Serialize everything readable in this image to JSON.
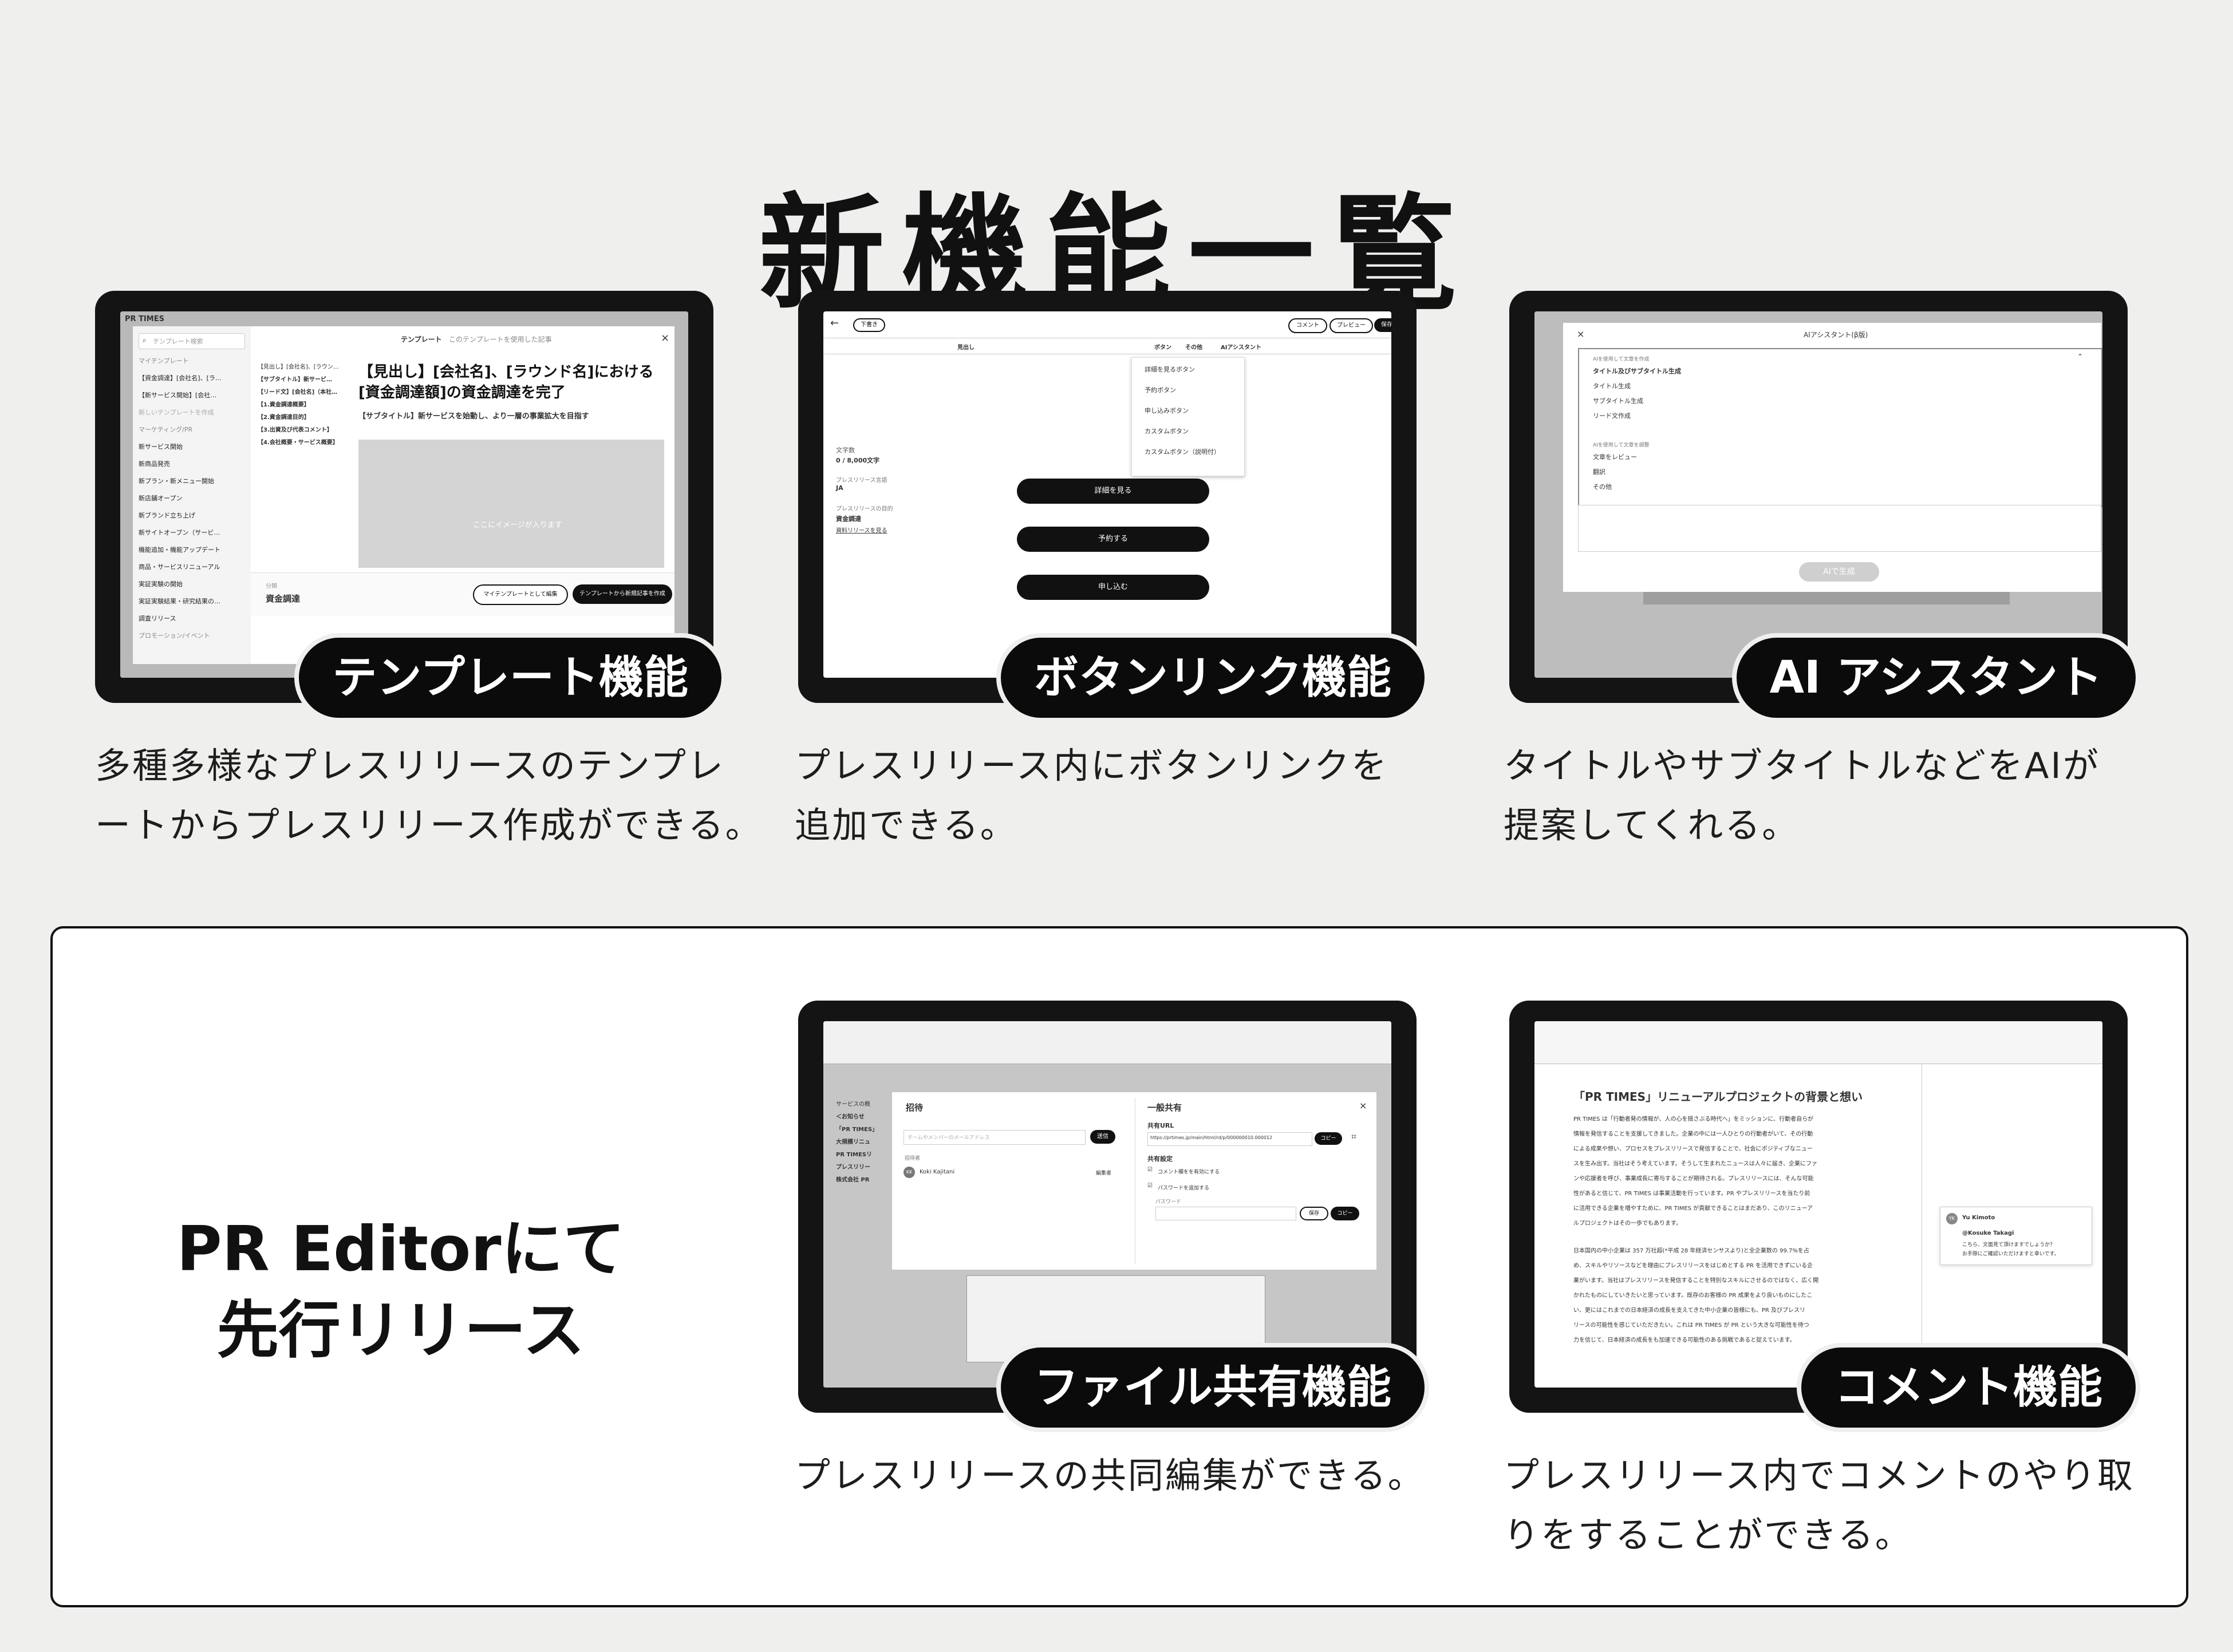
{
  "title": "新機能一覧",
  "early_release": {
    "line1": "PR Editorにて",
    "line2": "先行リリース"
  },
  "features": [
    {
      "label": "テンプレート機能",
      "desc_line1": "多種多様なプレスリリースのテンプレ",
      "desc_line2": "ートからプレスリリース作成ができる。",
      "screen": {
        "brand": "PR TIMES",
        "search_placeholder": "テンプレート検索",
        "tab_template": "テンプレート",
        "tab_used": "このテンプレートを使用した記事",
        "sidebar": [
          "マイテンプレート",
          "【資金調達】[会社名]、[ラ…",
          "【新サービス開始】[会社…",
          "新しいテンプレートを作成",
          "マーケティング/PR",
          "新サービス開始",
          "新商品発売",
          "新プラン・新メニュー開始",
          "新店舗オープン",
          "新ブランド立ち上げ",
          "新サイトオープン（サービ…",
          "機能追加・機能アップデート",
          "商品・サービスリニューアル",
          "実証実験の開始",
          "実証実験結果・研究結果の…",
          "調査リリース",
          "プロモーション/イベント"
        ],
        "outline": [
          "【見出し】[会社名]、[ラウン…",
          "【サブタイトル】新サービ…",
          "【リード文】[会社名]（本社…",
          "【1.資金調達概要】",
          "【2.資金調達目的】",
          "【3.出資及び代表コメント】",
          "【4.会社概要・サービス概要】"
        ],
        "headline": "【見出し】[会社名]、[ラウンド名]における[資金調達額]の資金調達を完了",
        "subtitle": "【サブタイトル】新サービスを始動し、より一層の事業拡大を目指す",
        "image_placeholder": "ここにイメージが入ります",
        "category_caption": "分類",
        "category_value": "資金調達",
        "btn_edit": "マイテンプレートとして編集",
        "btn_create": "テンプレートから新規記事を作成",
        "close_symbol": "×"
      }
    },
    {
      "label": "ボタンリンク機能",
      "desc_line1": "プレスリリース内にボタンリンクを",
      "desc_line2": "追加できる。",
      "screen": {
        "status": "下書き",
        "btn_comment": "コメント",
        "btn_preview": "プレビュー",
        "btn_save": "保存",
        "toolbar": [
          "見出し",
          "ボタン",
          "その他",
          "AIアシスタント"
        ],
        "menu": [
          "詳細を見るボタン",
          "予約ボタン",
          "申し込みボタン",
          "カスタムボタン",
          "カスタムボタン（説明付）"
        ],
        "char_caption": "文字数",
        "char_value": "0 / 8,000文字",
        "lang_caption": "プレスリリース言語",
        "lang_value": "JA",
        "purpose_caption": "プレスリリースの目的",
        "purpose_value": "資金調達",
        "purpose_link": "資料リリースを見る",
        "buttons": [
          "詳細を見る",
          "予約する",
          "申し込む"
        ]
      }
    },
    {
      "label": "AI アシスタント",
      "desc_line1": "タイトルやサブタイトルなどをAIが",
      "desc_line2": "提案してくれる。",
      "screen": {
        "modal_title": "AIアシスタント(β版)",
        "group1_caption": "AIを使用して文章を作成",
        "group1": [
          "タイトル及びサブタイトル生成",
          "タイトル生成",
          "サブタイトル生成",
          "リード文作成"
        ],
        "group2_caption": "AIを使用して文章を調整",
        "group2": [
          "文章をレビュー",
          "翻訳",
          "その他"
        ],
        "generate_button": "AIで生成"
      }
    },
    {
      "label": "ファイル共有機能",
      "desc_line1": "プレスリリースの共同編集ができる。",
      "desc_line2": "",
      "screen": {
        "invite_title": "招待",
        "invite_placeholder": "チームやメンバーのメールアドレス",
        "invite_button": "送信",
        "member_caption": "招待者",
        "member_initials": "KK",
        "member_name": "Koki Kajitani",
        "member_role": "編集者",
        "share_title": "一般共有",
        "share_url_caption": "共有URL",
        "share_url": "https://prtimes.jp/main/html/rd/p/000000010.000012",
        "copy_button": "コピー",
        "settings_caption": "共有設定",
        "opt_comment": "コメント欄をを有効にする",
        "opt_password": "パスワードを追加する",
        "password_caption": "パスワード",
        "save_button": "保存",
        "left_list": [
          "サービスの概",
          "＜お知らせ",
          "「PR TIMES」",
          "大規模リニュ",
          "PR TIMESリ",
          "プレスリリー",
          "株式会社 PR"
        ]
      }
    },
    {
      "label": "コメント機能",
      "desc_line1": "プレスリリース内でコメントのやり取",
      "desc_line2": "りをすることができる。",
      "screen": {
        "doc_title": "「PR TIMES」リニューアルプロジェクトの背景と想い",
        "para1": [
          "PR TIMES は「行動者発の情報が、人の心を揺さぶる時代へ」をミッションに、行動者自らが",
          "情報を発信することを支援してきました。企業の中には一人ひとりの行動者がいて、その行動",
          "による成果や想い、プロセスをプレスリリースで発信することで、社会にポジティブなニュー",
          "スを生み出す。当社はそう考えています。そうして生まれたニュースは人々に届き、企業にファ",
          "ンや応援者を呼び、事業成長に寄与することが期待される。プレスリリースには、そんな可能",
          "性があると信じて、PR TIMES は事業活動を行っています。PR やプレスリリースを当たり前",
          "に活用できる企業を増やすために、PR TIMES が貢献できることはまだあり、このリニューア",
          "ルプロジェクトはその一歩でもあります。"
        ],
        "para2": [
          "日本国内の中小企業は 357 万社超(*平成 28 年経済センサスより)と全企業数の 99.7%を占",
          "め、スキルやリソースなどを理由にプレスリリースをはじめとする PR を活用できずにいる企",
          "業がいます。当社はプレスリリースを発信することを特別なスキルにさせるのではなく、広く開",
          "かれたものにしていきたいと思っています。既存のお客様の PR 成果をより良いものにしたこ",
          "い、更にはこれまでの日本経済の成長を支えてきた中小企業の皆様にも、PR 及びプレスリ",
          "リースの可能性を感じていただきたい。これは PR TIMES が PR という大きな可能性を待つ",
          "力を信じて、日本経済の成長をも加速できる可能性のある挑戦であると捉えています。"
        ],
        "comment_author_initials": "YK",
        "comment_author": "Yu Kimoto",
        "comment_mention": "@Kosuke Takagi",
        "comment_body_1": "こちら、文面見て頂けますでしょうか？",
        "comment_body_2": "お手隙にご確認いただけますと幸いです。"
      }
    }
  ],
  "colors": {
    "background": "#efefed",
    "frame": "#141414",
    "label_bg": "#0b0b0b",
    "label_text": "#ffffff",
    "box_border": "#111111"
  }
}
